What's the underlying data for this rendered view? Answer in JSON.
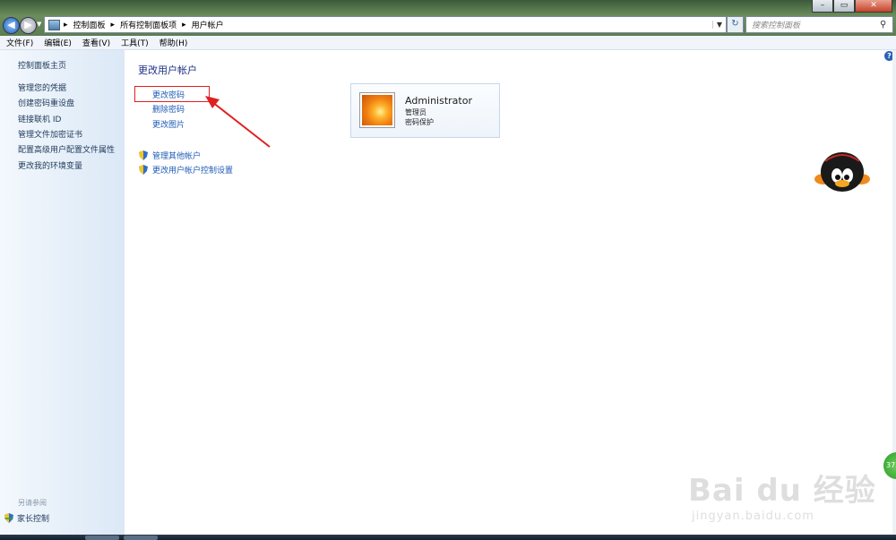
{
  "address": {
    "crumbs": [
      "控制面板",
      "所有控制面板项",
      "用户帐户"
    ],
    "separator": "▸",
    "dropdown_icon": "chevron-down-icon"
  },
  "search": {
    "placeholder": "搜索控制面板"
  },
  "window_controls": {
    "minimize": "–",
    "maximize": "▭",
    "close": "✕"
  },
  "menu": [
    "文件(F)",
    "编辑(E)",
    "查看(V)",
    "工具(T)",
    "帮助(H)"
  ],
  "sidebar": {
    "home": "控制面板主页",
    "links": [
      "管理您的凭据",
      "创建密码重设盘",
      "链接联机 ID",
      "管理文件加密证书",
      "配置高级用户配置文件属性",
      "更改我的环境变量"
    ],
    "see_also_heading": "另请参阅",
    "see_also_item": "家长控制"
  },
  "main": {
    "title": "更改用户帐户",
    "tasks": [
      "更改密码",
      "删除密码",
      "更改图片"
    ],
    "other_tasks": [
      "管理其他帐户",
      "更改用户帐户控制设置"
    ]
  },
  "account": {
    "name": "Administrator",
    "role": "管理员",
    "status": "密码保护"
  },
  "help_icon": "?",
  "badge_text": "37",
  "watermark": {
    "main": "Bai du 经验",
    "sub": "jingyan.baidu.com"
  },
  "colors": {
    "link": "#1e5bb5",
    "title": "#1e3287",
    "highlight_box": "#e02020"
  }
}
